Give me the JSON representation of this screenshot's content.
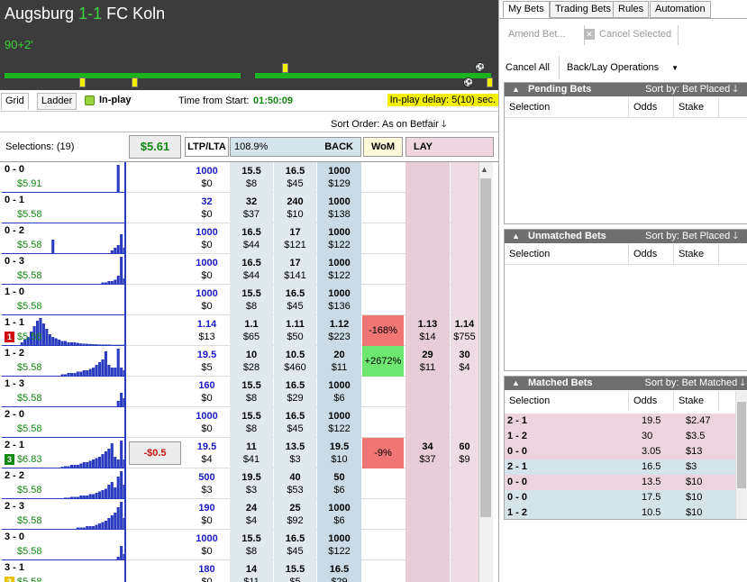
{
  "match": {
    "home": "Augsburg",
    "score": "1-1",
    "away": "FC Koln",
    "clock": "90+2'"
  },
  "toolbar": {
    "tab_grid": "Grid",
    "tab_ladder": "Ladder",
    "inplay": "In-play",
    "time_label": "Time from Start:",
    "time_value": "01:50:09",
    "delay": "In-play delay: 5(10) sec."
  },
  "sort": {
    "label": "Sort Order: As on Betfair"
  },
  "grid_header": {
    "selections": "Selections: (19)",
    "total": "$5.61",
    "ltp": "LTP/LTA",
    "book": "108.9%",
    "back": "BACK",
    "wom": "WoM",
    "lay": "LAY"
  },
  "rows": [
    {
      "name": "0 - 0",
      "val": "$5.91",
      "ltp": "1000",
      "ltp2": "$0",
      "b": [
        [
          "15.5",
          "$8"
        ],
        [
          "16.5",
          "$45"
        ],
        [
          "1000",
          "$129"
        ]
      ],
      "wom": "",
      "l": [
        [
          "",
          ""
        ],
        [
          "",
          ""
        ]
      ],
      "spark": [
        0,
        0,
        0,
        0,
        0,
        0,
        0,
        0,
        0,
        0,
        0,
        0,
        0,
        0,
        0,
        0,
        0,
        0,
        0,
        0,
        0,
        0,
        0,
        0,
        0,
        0,
        0,
        0,
        0,
        0,
        0,
        0,
        0,
        0,
        0,
        0,
        0,
        1,
        0,
        0
      ]
    },
    {
      "name": "0 - 1",
      "val": "$5.58",
      "ltp": "32",
      "ltp2": "$0",
      "b": [
        [
          "32",
          "$37"
        ],
        [
          "240",
          "$10"
        ],
        [
          "1000",
          "$138"
        ]
      ],
      "wom": "",
      "l": [
        [
          "",
          ""
        ],
        [
          "",
          ""
        ]
      ],
      "spark": [
        0,
        0,
        0,
        0,
        0,
        0,
        0,
        0,
        0,
        0,
        0,
        0,
        0,
        0,
        0,
        0,
        0,
        0,
        0,
        0,
        0,
        0,
        0,
        0,
        0,
        0,
        0,
        0,
        0,
        0,
        0,
        0,
        0,
        0,
        0,
        0,
        0,
        0,
        0,
        0
      ]
    },
    {
      "name": "0 - 2",
      "val": "$5.58",
      "ltp": "1000",
      "ltp2": "$0",
      "b": [
        [
          "16.5",
          "$44"
        ],
        [
          "17",
          "$121"
        ],
        [
          "1000",
          "$122"
        ]
      ],
      "wom": "",
      "l": [
        [
          "",
          ""
        ],
        [
          "",
          ""
        ]
      ],
      "spark": [
        0,
        0,
        0,
        0,
        0,
        0,
        0,
        0,
        0,
        0,
        0,
        0,
        0,
        0,
        0,
        0,
        0.5,
        0,
        0,
        0,
        0,
        0,
        0,
        0,
        0,
        0,
        0,
        0,
        0,
        0,
        0,
        0,
        0,
        0,
        0,
        0.1,
        0.2,
        0.3,
        0.7,
        0.2
      ]
    },
    {
      "name": "0 - 3",
      "val": "$5.58",
      "ltp": "1000",
      "ltp2": "$0",
      "b": [
        [
          "16.5",
          "$44"
        ],
        [
          "17",
          "$141"
        ],
        [
          "1000",
          "$122"
        ]
      ],
      "wom": "",
      "l": [
        [
          "",
          ""
        ],
        [
          "",
          ""
        ]
      ],
      "spark": [
        0,
        0,
        0,
        0,
        0,
        0,
        0,
        0,
        0,
        0,
        0,
        0,
        0,
        0,
        0,
        0,
        0,
        0,
        0,
        0,
        0,
        0,
        0,
        0,
        0,
        0,
        0,
        0,
        0,
        0,
        0,
        0,
        0.05,
        0.05,
        0.1,
        0.1,
        0.15,
        0.3,
        1,
        0.2
      ]
    },
    {
      "name": "1 - 0",
      "val": "$5.58",
      "ltp": "1000",
      "ltp2": "$0",
      "b": [
        [
          "15.5",
          "$8"
        ],
        [
          "16.5",
          "$45"
        ],
        [
          "1000",
          "$136"
        ]
      ],
      "wom": "",
      "l": [
        [
          "",
          ""
        ],
        [
          "",
          ""
        ]
      ],
      "spark": [
        0,
        0,
        0,
        0,
        0,
        0,
        0,
        0,
        0,
        0,
        0,
        0,
        0,
        0,
        0,
        0,
        0,
        0,
        0,
        0,
        0,
        0,
        0,
        0,
        0,
        0,
        0,
        0,
        0,
        0,
        0,
        0,
        0,
        0,
        0,
        0,
        0,
        0,
        0,
        0
      ]
    },
    {
      "name": "1 - 1",
      "val": "$5.58",
      "badge": "1",
      "badge_color": "#d01010",
      "ltp": "1.14",
      "ltp2": "$13",
      "b": [
        [
          "1.1",
          "$65"
        ],
        [
          "1.11",
          "$50"
        ],
        [
          "1.12",
          "$223"
        ]
      ],
      "wom": "-168%",
      "wom_color": "#f07575",
      "l": [
        [
          "1.13",
          "$14"
        ],
        [
          "1.14",
          "$755"
        ]
      ],
      "spark": [
        0,
        0,
        0,
        0,
        0,
        0,
        0.1,
        0.2,
        0.3,
        0.5,
        0.7,
        0.9,
        1,
        0.8,
        0.6,
        0.4,
        0.3,
        0.25,
        0.2,
        0.15,
        0.15,
        0.1,
        0.1,
        0.1,
        0.08,
        0.06,
        0.05,
        0.05,
        0.04,
        0.03,
        0.03,
        0.02,
        0.02,
        0.02,
        0.02,
        0.01,
        0.01,
        0.01,
        0.01,
        0.01
      ]
    },
    {
      "name": "1 - 2",
      "val": "$5.58",
      "ltp": "19.5",
      "ltp2": "$5",
      "b": [
        [
          "10",
          "$28"
        ],
        [
          "10.5",
          "$460"
        ],
        [
          "20",
          "$11"
        ]
      ],
      "wom": "+2672%",
      "wom_color": "#6fe66f",
      "l": [
        [
          "29",
          "$11"
        ],
        [
          "30",
          "$4"
        ]
      ],
      "spark": [
        0,
        0,
        0,
        0,
        0,
        0,
        0,
        0,
        0,
        0,
        0,
        0,
        0,
        0,
        0,
        0,
        0,
        0,
        0,
        0.05,
        0.05,
        0.1,
        0.1,
        0.1,
        0.15,
        0.15,
        0.2,
        0.2,
        0.25,
        0.3,
        0.4,
        0.5,
        0.6,
        0.9,
        0.4,
        0.3,
        0.3,
        1,
        0.3,
        0.2
      ]
    },
    {
      "name": "1 - 3",
      "val": "$5.58",
      "ltp": "160",
      "ltp2": "$0",
      "b": [
        [
          "15.5",
          "$8"
        ],
        [
          "16.5",
          "$29"
        ],
        [
          "1000",
          "$6"
        ]
      ],
      "wom": "",
      "l": [
        [
          "",
          ""
        ],
        [
          "",
          ""
        ]
      ],
      "spark": [
        0,
        0,
        0,
        0,
        0,
        0,
        0,
        0,
        0,
        0,
        0,
        0,
        0,
        0,
        0,
        0,
        0,
        0,
        0,
        0,
        0,
        0,
        0,
        0,
        0,
        0,
        0,
        0,
        0,
        0,
        0,
        0,
        0,
        0,
        0,
        0,
        0,
        0.2,
        0.5,
        0.3
      ]
    },
    {
      "name": "2 - 0",
      "val": "$5.58",
      "ltp": "1000",
      "ltp2": "$0",
      "b": [
        [
          "15.5",
          "$8"
        ],
        [
          "16.5",
          "$45"
        ],
        [
          "1000",
          "$122"
        ]
      ],
      "wom": "",
      "l": [
        [
          "",
          ""
        ],
        [
          "",
          ""
        ]
      ],
      "spark": [
        0,
        0,
        0,
        0,
        0,
        0,
        0,
        0,
        0,
        0,
        0,
        0,
        0,
        0,
        0,
        0,
        0,
        0,
        0,
        0,
        0,
        0,
        0,
        0,
        0,
        0,
        0,
        0,
        0,
        0,
        0,
        0,
        0,
        0,
        0,
        0,
        0,
        0,
        0,
        0
      ]
    },
    {
      "name": "2 - 1",
      "val": "$6.83",
      "badge": "3",
      "badge_color": "#118811",
      "pl": "-$0.5",
      "ltp": "19.5",
      "ltp2": "$4",
      "b": [
        [
          "11",
          "$41"
        ],
        [
          "13.5",
          "$3"
        ],
        [
          "19.5",
          "$10"
        ]
      ],
      "wom": "-9%",
      "wom_color": "#f07575",
      "l": [
        [
          "34",
          "$37"
        ],
        [
          "60",
          "$9"
        ]
      ],
      "spark": [
        0,
        0,
        0,
        0,
        0,
        0,
        0,
        0,
        0,
        0,
        0,
        0,
        0,
        0,
        0,
        0,
        0,
        0,
        0,
        0.03,
        0.05,
        0.05,
        0.1,
        0.1,
        0.1,
        0.15,
        0.2,
        0.2,
        0.25,
        0.3,
        0.35,
        0.4,
        0.5,
        0.6,
        0.7,
        0.9,
        0.4,
        0.3,
        1,
        0.3
      ]
    },
    {
      "name": "2 - 2",
      "val": "$5.58",
      "ltp": "500",
      "ltp2": "$3",
      "b": [
        [
          "19.5",
          "$3"
        ],
        [
          "40",
          "$53"
        ],
        [
          "50",
          "$6"
        ]
      ],
      "wom": "",
      "l": [
        [
          "",
          ""
        ],
        [
          "",
          ""
        ]
      ],
      "spark": [
        0,
        0,
        0,
        0,
        0,
        0,
        0,
        0,
        0,
        0,
        0,
        0,
        0,
        0,
        0,
        0,
        0,
        0,
        0,
        0,
        0.02,
        0.02,
        0.05,
        0.05,
        0.05,
        0.1,
        0.1,
        0.1,
        0.15,
        0.15,
        0.2,
        0.25,
        0.3,
        0.35,
        0.5,
        0.6,
        0.4,
        0.8,
        1,
        0.5
      ]
    },
    {
      "name": "2 - 3",
      "val": "$5.58",
      "ltp": "190",
      "ltp2": "$0",
      "b": [
        [
          "24",
          "$4"
        ],
        [
          "25",
          "$92"
        ],
        [
          "1000",
          "$6"
        ]
      ],
      "wom": "",
      "l": [
        [
          "",
          ""
        ],
        [
          "",
          ""
        ]
      ],
      "spark": [
        0,
        0,
        0,
        0,
        0,
        0,
        0,
        0,
        0,
        0,
        0,
        0,
        0,
        0,
        0,
        0,
        0,
        0,
        0,
        0,
        0,
        0,
        0,
        0,
        0.05,
        0.05,
        0.05,
        0.1,
        0.1,
        0.1,
        0.15,
        0.2,
        0.25,
        0.3,
        0.4,
        0.5,
        0.6,
        0.8,
        1,
        0.4
      ]
    },
    {
      "name": "3 - 0",
      "val": "$5.58",
      "ltp": "1000",
      "ltp2": "$0",
      "b": [
        [
          "15.5",
          "$8"
        ],
        [
          "16.5",
          "$45"
        ],
        [
          "1000",
          "$122"
        ]
      ],
      "wom": "",
      "l": [
        [
          "",
          ""
        ],
        [
          "",
          ""
        ]
      ],
      "spark": [
        0,
        0,
        0,
        0,
        0,
        0,
        0,
        0,
        0,
        0,
        0,
        0,
        0,
        0,
        0,
        0,
        0,
        0,
        0,
        0,
        0,
        0,
        0,
        0,
        0,
        0,
        0,
        0,
        0,
        0,
        0,
        0,
        0,
        0,
        0,
        0,
        0,
        0.1,
        0.5,
        0.2
      ]
    },
    {
      "name": "3 - 1",
      "val": "$5.58",
      "badge": "3",
      "badge_color": "#e8c400",
      "ltp": "180",
      "ltp2": "$0",
      "b": [
        [
          "14",
          "$11"
        ],
        [
          "15.5",
          "$5"
        ],
        [
          "16.5",
          "$29"
        ]
      ],
      "wom": "",
      "l": [
        [
          "",
          ""
        ],
        [
          "",
          ""
        ]
      ],
      "spark": [
        0,
        0,
        0,
        0,
        0,
        0,
        0,
        0,
        0,
        0,
        0,
        0,
        0,
        0,
        0,
        0,
        0,
        0,
        0,
        0,
        0,
        0,
        0,
        0,
        0,
        0,
        0,
        0,
        0,
        0,
        0,
        0,
        0,
        0,
        0,
        0,
        0,
        0.1,
        0.3,
        0.2
      ]
    }
  ],
  "right": {
    "tabs": [
      "My Bets",
      "Trading Bets",
      "Rules",
      "Automation"
    ],
    "amend": "Amend Bet...",
    "cancel_selected": "Cancel Selected",
    "cancel_all": "Cancel All",
    "backlay": "Back/Lay Operations",
    "pending": {
      "title": "Pending Bets",
      "sort": "Sort by: Bet Placed"
    },
    "unmatched": {
      "title": "Unmatched Bets",
      "sort": "Sort by: Bet Placed"
    },
    "matched": {
      "title": "Matched Bets",
      "sort": "Sort by: Bet Matched"
    },
    "cols": {
      "selection": "Selection",
      "odds": "Odds",
      "stake": "Stake"
    },
    "matched_bets": [
      {
        "sel": "2 - 1",
        "odds": "19.5",
        "stake": "$2.47",
        "side": "lay"
      },
      {
        "sel": "1 - 2",
        "odds": "30",
        "stake": "$3.5",
        "side": "lay"
      },
      {
        "sel": "0 - 0",
        "odds": "3.05",
        "stake": "$13",
        "side": "lay"
      },
      {
        "sel": "2 - 1",
        "odds": "16.5",
        "stake": "$3",
        "side": "back"
      },
      {
        "sel": "0 - 0",
        "odds": "13.5",
        "stake": "$10",
        "side": "lay"
      },
      {
        "sel": "0 - 0",
        "odds": "17.5",
        "stake": "$10",
        "side": "back"
      },
      {
        "sel": "1 - 2",
        "odds": "10.5",
        "stake": "$10",
        "side": "back"
      }
    ]
  },
  "colors": {
    "header_bg": "#3c3c3c",
    "score_green": "#39d239",
    "back": "#dfe9ee",
    "lay": "#e8cdd8"
  }
}
